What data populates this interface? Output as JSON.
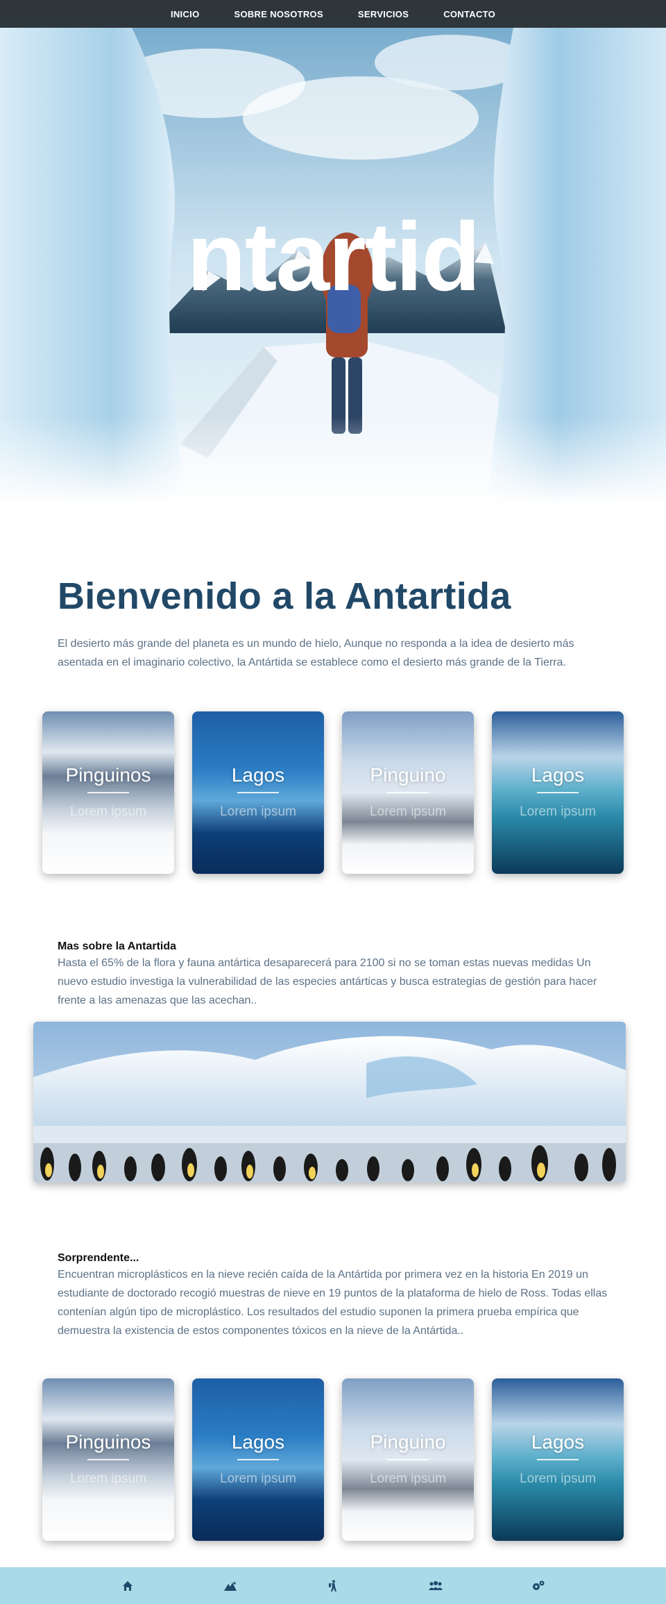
{
  "nav": {
    "items": [
      {
        "label": "INICIO"
      },
      {
        "label": "SOBRE NOSOTROS"
      },
      {
        "label": "SERVICIOS"
      },
      {
        "label": "CONTACTO"
      }
    ]
  },
  "hero": {
    "title": "ntartid"
  },
  "welcome": {
    "title": "Bienvenido a la Antartida",
    "text": "El desierto más grande del planeta es un mundo de hielo, Aunque no responda a la idea de desierto más asentada en el imaginario colectivo, la Antártida se establece como el desierto más grande de la Tierra."
  },
  "cards_row1": [
    {
      "title": "Pinguinos",
      "subtitle": "Lorem ipsum"
    },
    {
      "title": "Lagos",
      "subtitle": "Lorem ipsum"
    },
    {
      "title": "Pinguino",
      "subtitle": "Lorem ipsum"
    },
    {
      "title": "Lagos",
      "subtitle": "Lorem ipsum"
    }
  ],
  "section_more": {
    "title": "Mas sobre la Antartida",
    "text": "Hasta el 65% de la flora y fauna antártica desaparecerá para 2100 si no se toman estas nuevas medidas Un nuevo estudio investiga la vulnerabilidad de las especies antárticas y busca estrategias de gestión para hacer frente a las amenazas que las acechan.."
  },
  "section_surprise": {
    "title": "Sorprendente...",
    "text": "Encuentran microplásticos en la nieve recién caída de la Antártida por primera vez en la historia En 2019 un estudiante de doctorado recogió muestras de nieve en 19 puntos de la plataforma de hielo de Ross. Todas ellas contenían algún tipo de microplástico. Los resultados del estudio suponen la primera prueba empírica que demuestra la existencia de estos componentes tóxicos en la nieve de la Antártida.."
  },
  "cards_row2": [
    {
      "title": "Pinguinos",
      "subtitle": "Lorem ipsum"
    },
    {
      "title": "Lagos",
      "subtitle": "Lorem ipsum"
    },
    {
      "title": "Pinguino",
      "subtitle": "Lorem ipsum"
    },
    {
      "title": "Lagos",
      "subtitle": "Lorem ipsum"
    }
  ],
  "footer": {
    "icons": [
      "home-icon",
      "mountain-icon",
      "hiker-icon",
      "group-icon",
      "gears-icon"
    ]
  },
  "colors": {
    "nav_bg": "#2c3034",
    "title": "#214867",
    "body_text": "#5b7186",
    "footer_bg": "#a9dae8",
    "footer_icon": "#1f4a6b"
  }
}
